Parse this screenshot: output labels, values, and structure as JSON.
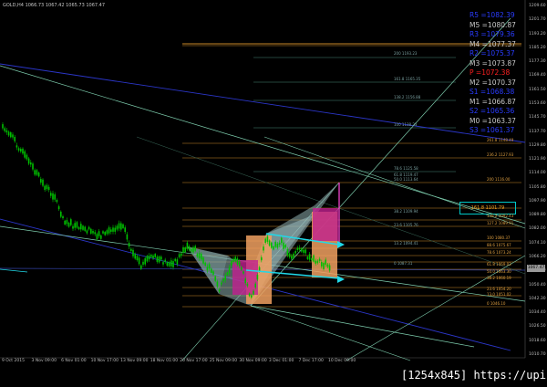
{
  "window": {
    "symbol_line": "GOLD,H4 1066.73 1067.42 1065.73 1067.47"
  },
  "pivots": [
    {
      "label": "R5",
      "value": "1082.39",
      "color": "#2a3cff"
    },
    {
      "label": "M5",
      "value": "1080.87",
      "color": "#c8c8c8"
    },
    {
      "label": "R3",
      "value": "1079.36",
      "color": "#2a3cff"
    },
    {
      "label": "M4",
      "value": "1077.37",
      "color": "#c8c8c8"
    },
    {
      "label": "R2",
      "value": "1075.37",
      "color": "#2a3cff"
    },
    {
      "label": "M3",
      "value": "1073.87",
      "color": "#c8c8c8"
    },
    {
      "label": "P",
      "value": "1072.38",
      "color": "#ff2020"
    },
    {
      "label": "M2",
      "value": "1070.37",
      "color": "#c8c8c8"
    },
    {
      "label": "S1",
      "value": "1068.38",
      "color": "#2a3cff"
    },
    {
      "label": "M1",
      "value": "1066.87",
      "color": "#c8c8c8"
    },
    {
      "label": "S2",
      "value": "1065.36",
      "color": "#2a3cff"
    },
    {
      "label": "M0",
      "value": "1063.37",
      "color": "#c8c8c8"
    },
    {
      "label": "S3",
      "value": "1061.37",
      "color": "#2a3cff"
    }
  ],
  "fib_box_label": "161.8 1101.79",
  "fib_levels_right": [
    "261.8 1148.49",
    "236.2 1127.93",
    "200 1116.00",
    "138.2 1092.43",
    "127.2 1089.91",
    "100 1080.37",
    "88.6 1075.67",
    "78.6 1073.24",
    "61.8 1069.03",
    "50.0 1063.30",
    "38.2 1060.19",
    "23.6 1054.20",
    "13.0 1051.02",
    "0 1046.10"
  ],
  "fib_levels_mid": [
    "200 1193.23",
    "161.8 1165.35",
    "138.2 1156.88",
    "100 1138.23",
    "78.6 1125.58",
    "61.8 1119.47",
    "50.0 1113.64",
    "38.2 1109.94",
    "23.6 1105.76",
    "13.2 1094.41",
    "0 1087.31"
  ],
  "price_axis": [
    "1209.60",
    "1201.70",
    "1193.20",
    "1185.20",
    "1177.30",
    "1169.40",
    "1161.50",
    "1153.60",
    "1145.70",
    "1137.70",
    "1129.80",
    "1121.90",
    "1114.00",
    "1105.80",
    "1097.90",
    "1089.80",
    "1082.00",
    "1074.10",
    "1066.20",
    "1058.30",
    "1050.40",
    "1042.30",
    "1034.40",
    "1026.50",
    "1018.60",
    "1010.70"
  ],
  "price_tag": "1067.47",
  "time_axis": [
    "9 Oct 2015",
    "3 Nov 09:00",
    "6 Nov 01:00",
    "10 Nov 17:00",
    "13 Nov 09:00",
    "18 Nov 01:00",
    "20 Nov 17:00",
    "25 Nov 09:00",
    "30 Nov 09:00",
    "3 Dec 01:00",
    "7 Dec 17:00",
    "10 Dec 09:00"
  ],
  "watermark": "[1254x845] https://upic.me/",
  "colors": {
    "background": "#000000",
    "bull_candle": "#00c000",
    "fib_line": "#d4902a",
    "trend_line": "#7fd0b0",
    "channel_line": "#2b36c8",
    "harmonic_fill": "#8fb0b0",
    "box_orange": "#f0a060",
    "box_magenta": "#c02090",
    "cyan_arrow": "#20d8e8"
  }
}
